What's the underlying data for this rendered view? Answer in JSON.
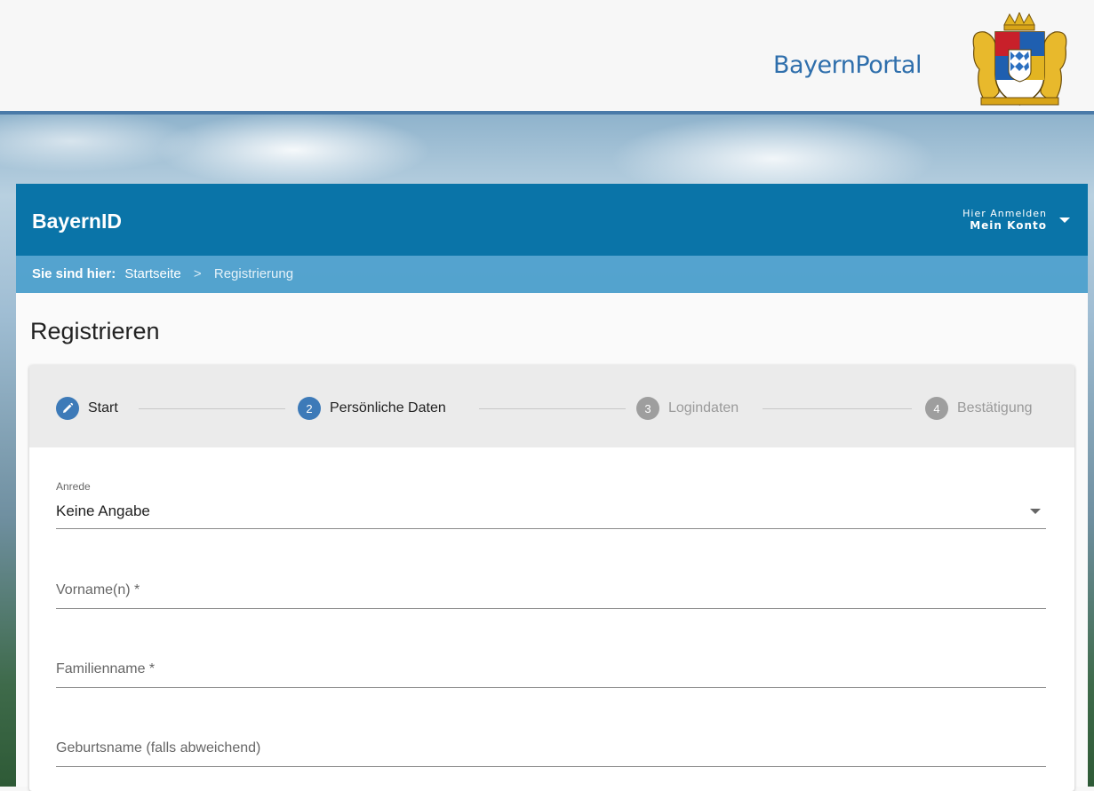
{
  "header": {
    "portal_title": "BayernPortal",
    "crest_icon": "bavarian-coat-of-arms-icon"
  },
  "app_bar": {
    "title": "BayernID",
    "login_small": "Hier Anmelden",
    "login_main": "Mein Konto",
    "colors": {
      "bar": "#0a74a8",
      "breadcrumb": "#489ecd"
    }
  },
  "breadcrumb": {
    "label": "Sie sind hier:",
    "items": [
      "Startseite",
      "Registrierung"
    ],
    "separator": ">"
  },
  "page": {
    "title": "Registrieren"
  },
  "stepper": {
    "steps": [
      {
        "number": "",
        "icon": "pencil-icon",
        "label": "Start",
        "state": "done"
      },
      {
        "number": "2",
        "label": "Persönliche Daten",
        "state": "active"
      },
      {
        "number": "3",
        "label": "Logindaten",
        "state": "inactive"
      },
      {
        "number": "4",
        "label": "Bestätigung",
        "state": "inactive"
      }
    ]
  },
  "form": {
    "salutation": {
      "label": "Anrede",
      "value": "Keine Angabe"
    },
    "first_name": {
      "placeholder": "Vorname(n) *"
    },
    "last_name": {
      "placeholder": "Familienname *"
    },
    "birth_name": {
      "placeholder": "Geburtsname (falls abweichend)"
    }
  }
}
